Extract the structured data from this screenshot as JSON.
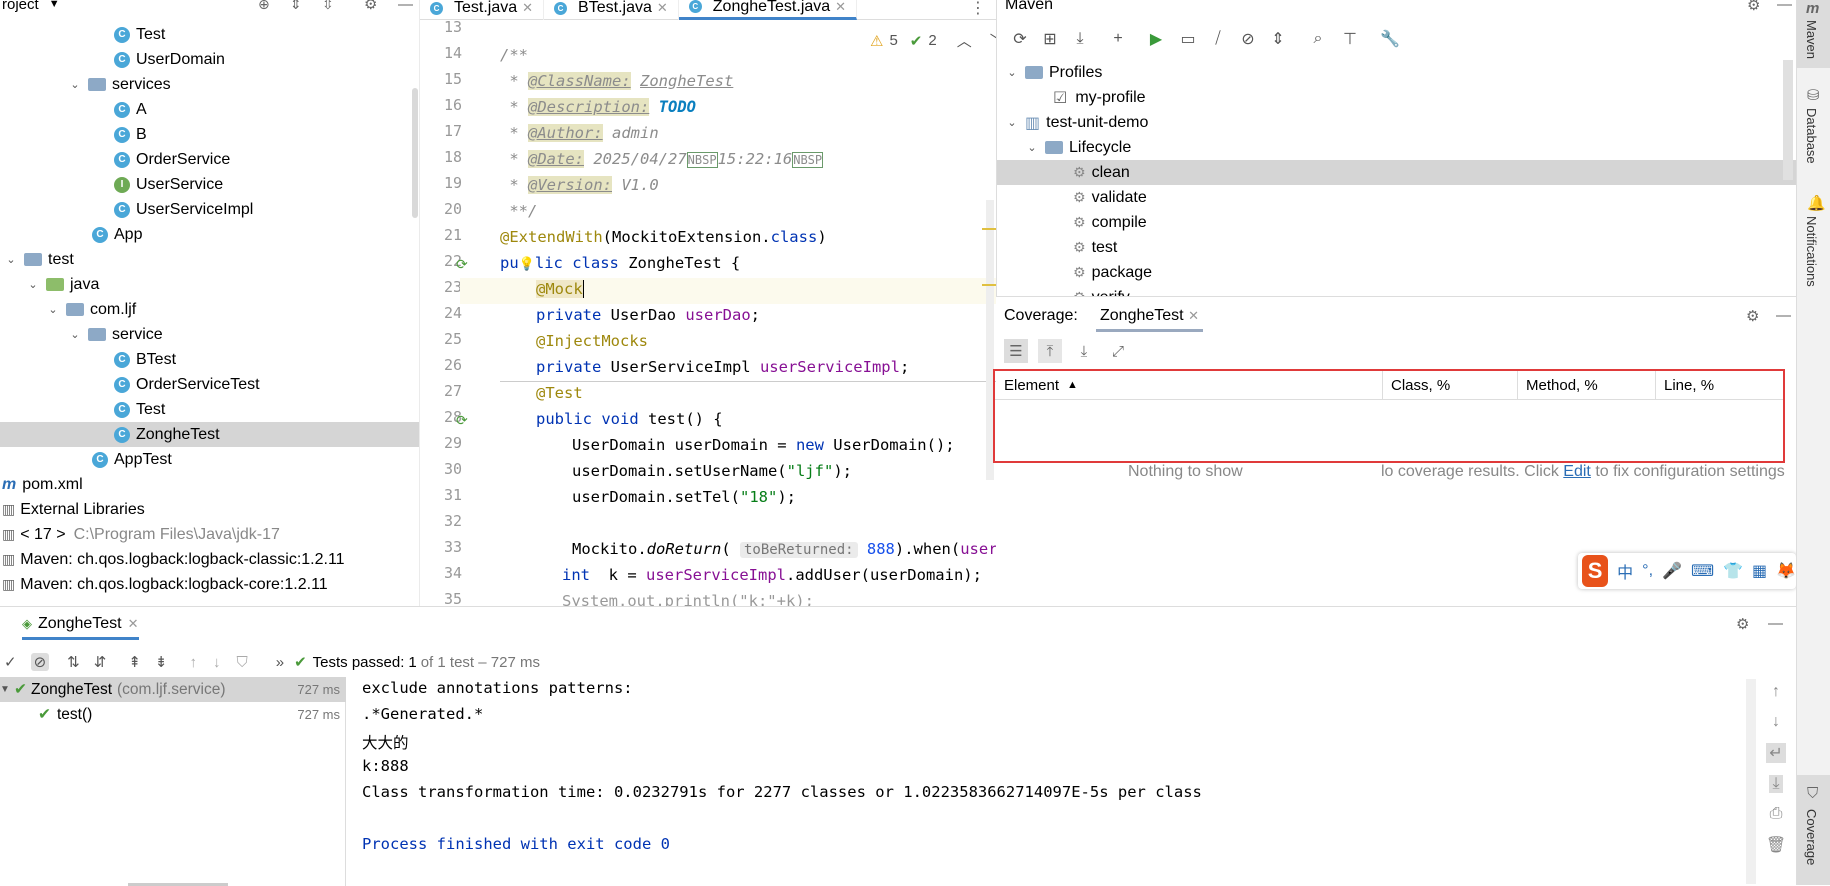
{
  "project": {
    "header": "roject",
    "rows": [
      {
        "label": "Test",
        "type": "class",
        "indent": 112
      },
      {
        "label": "UserDomain",
        "type": "class",
        "indent": 112
      },
      {
        "label": "services",
        "type": "folder",
        "indent": 68,
        "arrow": "v"
      },
      {
        "label": "A",
        "type": "class",
        "indent": 112
      },
      {
        "label": "B",
        "type": "class",
        "indent": 112
      },
      {
        "label": "OrderService",
        "type": "class",
        "indent": 112
      },
      {
        "label": "UserService",
        "type": "interface",
        "indent": 112
      },
      {
        "label": "UserServiceImpl",
        "type": "class",
        "indent": 112
      },
      {
        "label": "App",
        "type": "class",
        "indent": 90
      },
      {
        "label": "test",
        "type": "folder",
        "indent": 4,
        "arrow": "v"
      },
      {
        "label": "java",
        "type": "folder-green",
        "indent": 26,
        "arrow": "v"
      },
      {
        "label": "com.ljf",
        "type": "folder",
        "indent": 46,
        "arrow": "v"
      },
      {
        "label": "service",
        "type": "folder",
        "indent": 68,
        "arrow": "v"
      },
      {
        "label": "BTest",
        "type": "class",
        "indent": 112
      },
      {
        "label": "OrderServiceTest",
        "type": "class",
        "indent": 112
      },
      {
        "label": "Test",
        "type": "class",
        "indent": 112
      },
      {
        "label": "ZongheTest",
        "type": "class",
        "indent": 112,
        "selected": true
      },
      {
        "label": "AppTest",
        "type": "class",
        "indent": 90
      },
      {
        "label": "pom.xml",
        "type": "maven",
        "indent": 0
      },
      {
        "label": "External Libraries",
        "type": "lib",
        "indent": 0
      },
      {
        "label": "< 17 >",
        "sub": "C:\\Program Files\\Java\\jdk-17",
        "type": "lib",
        "indent": 0
      },
      {
        "label": "Maven: ch.qos.logback:logback-classic:1.2.11",
        "type": "lib",
        "indent": 0
      },
      {
        "label": "Maven: ch.qos.logback:logback-core:1.2.11",
        "type": "lib",
        "indent": 0
      }
    ]
  },
  "editor": {
    "tabs": [
      {
        "label": "Test.java",
        "active": false
      },
      {
        "label": "BTest.java",
        "active": false
      },
      {
        "label": "ZongheTest.java",
        "active": true
      }
    ],
    "warnings": "5",
    "checks": "2",
    "line_numbers": [
      "13",
      "14",
      "15",
      "16",
      "17",
      "18",
      "19",
      "20",
      "21",
      "22",
      "23",
      "24",
      "25",
      "26",
      "27",
      "28",
      "29",
      "30",
      "31",
      "32",
      "33",
      "34",
      "35"
    ],
    "javadoc": {
      "open": "/**",
      "classname_tag": "@ClassName:",
      "classname_val": "ZongheTest",
      "desc_tag": "@Description:",
      "desc_val": "TODO",
      "author_tag": "@Author:",
      "author_val": "admin",
      "date_tag": "@Date:",
      "date_val": "2025/04/27",
      "nbsp": "NBSP",
      "time_val": "15:22:16",
      "version_tag": "@Version:",
      "version_val": "V1.0",
      "close": "**/"
    },
    "code": {
      "extend_ann": "@ExtendWith",
      "extend_arg": "(MockitoExtension.",
      "extend_class": "class",
      "extend_end": ")",
      "pub": "pu",
      "pub2": "lic",
      "class_kw": "class",
      "class_name": " ZongheTest {",
      "mock_ann": "@Mock",
      "private1": "private",
      "userdao_type": " UserDao ",
      "userdao_field": "userDao",
      "semi": ";",
      "inject_ann": "@InjectMocks",
      "private2": "private",
      "impl_type": " UserServiceImpl ",
      "impl_field": "userServiceImpl",
      "test_ann": "@Test",
      "public_void": "public void",
      "test_method": " test() {",
      "l29a": "UserDomain userDomain = ",
      "l29new": "new",
      "l29b": " UserDomain();",
      "l30a": "userDomain.setUserName(",
      "l30str": "\"ljf\"",
      "l30b": ");",
      "l31a": "userDomain.setTel(",
      "l31str": "\"18\"",
      "l31b": ");",
      "l33a": "Mockito.",
      "l33m": "doReturn",
      "l33p": "( ",
      "l33hint": "toBeReturned:",
      "l33num": " 888",
      "l33b": ").when(",
      "l33c": "userDa",
      "l34int": "int",
      "l34a": "  k = ",
      "l34f": "userServiceImpl",
      "l34b": ".addUser(userDomain);",
      "l35": "System.out.println(\"k:\"+k);"
    }
  },
  "maven": {
    "title": "Maven",
    "rows": [
      {
        "label": "Profiles",
        "indent": 26,
        "arrow": "v",
        "kind": "folder"
      },
      {
        "label": "my-profile",
        "indent": 56,
        "kind": "check"
      },
      {
        "label": "test-unit-demo",
        "indent": 26,
        "arrow": "v",
        "kind": "module"
      },
      {
        "label": "Lifecycle",
        "indent": 46,
        "arrow": "v",
        "kind": "folder"
      },
      {
        "label": "clean",
        "indent": 76,
        "kind": "gear",
        "selected": true
      },
      {
        "label": "validate",
        "indent": 76,
        "kind": "gear"
      },
      {
        "label": "compile",
        "indent": 76,
        "kind": "gear"
      },
      {
        "label": "test",
        "indent": 76,
        "kind": "gear"
      },
      {
        "label": "package",
        "indent": 76,
        "kind": "gear"
      },
      {
        "label": "verify",
        "indent": 76,
        "kind": "gear"
      }
    ]
  },
  "coverage": {
    "label": "Coverage:",
    "tab": "ZongheTest",
    "columns": [
      "Element",
      "Class, %",
      "Method, %",
      "Line, %"
    ],
    "empty_text": "Nothing to show",
    "results_text_a": "lo coverage results. Click ",
    "results_link": "Edit",
    "results_text_b": " to fix configuration settings"
  },
  "rightbar": {
    "items": [
      "Maven",
      "Database",
      "Notifications",
      "Coverage"
    ]
  },
  "run": {
    "tab": "ZongheTest",
    "status_prefix": "Tests passed:",
    "status_count": "1",
    "status_rest": "of 1 test – 727 ms",
    "tree": [
      {
        "label": "ZongheTest",
        "sub": "(com.ljf.service)",
        "time": "727 ms"
      },
      {
        "label": "test()",
        "sub": "",
        "time": "727 ms"
      }
    ],
    "output": [
      "exclude annotations patterns:",
      ".*Generated.*",
      "大大的",
      "k:888",
      "Class transformation time: 0.0232791s for 2277 classes or 1.0223583662714097E-5s per class",
      "",
      "Process finished with exit code 0"
    ]
  },
  "ime": {
    "logo": "S",
    "lang": "中"
  },
  "colors": {
    "accent": "#4083c9",
    "red_box": "#e03a3a",
    "selection": "#d5d5d5"
  }
}
